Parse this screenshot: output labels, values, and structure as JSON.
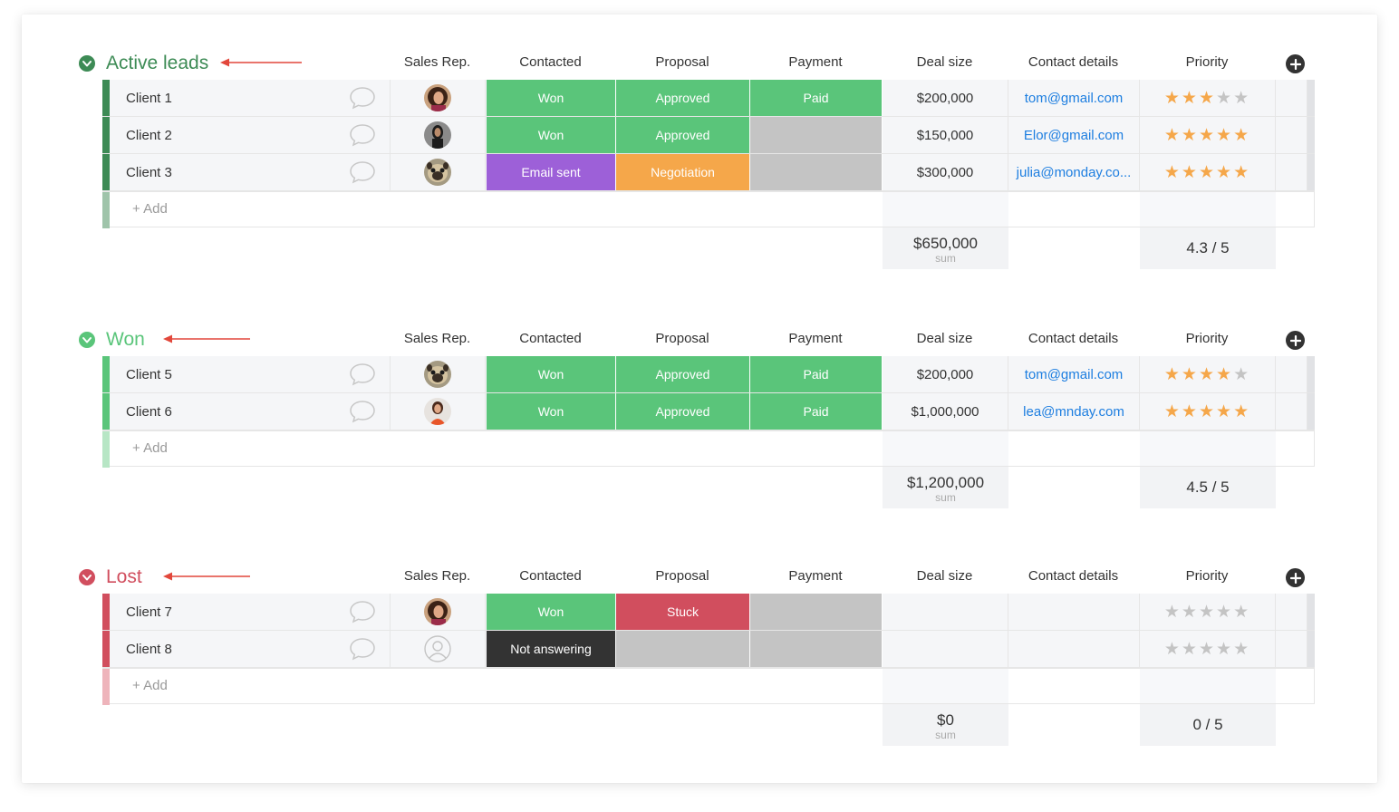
{
  "columns": {
    "sales_rep": "Sales Rep.",
    "contacted": "Contacted",
    "proposal": "Proposal",
    "payment": "Payment",
    "deal_size": "Deal size",
    "contact_details": "Contact details",
    "priority": "Priority"
  },
  "colors": {
    "won_green": "#5ac57a",
    "approved_green": "#5ac57a",
    "paid_green": "#5ac57a",
    "email_sent_purple": "#9d60d8",
    "negotiation_orange": "#f5a74a",
    "stuck_red": "#d14e5e",
    "not_answering_black": "#333333",
    "empty_gray": "#c4c4c4",
    "star_orange": "#f5a74a",
    "star_gray": "#c4c4c4",
    "link_blue": "#1d7ee0"
  },
  "groups": [
    {
      "title": "Active leads",
      "color": "#3d8b55",
      "add_bar_color": "#9fc4aa",
      "add_label": "+ Add",
      "rows": [
        {
          "name": "Client 1",
          "avatar": "woman-curly-hair",
          "contacted": "Won",
          "contacted_color": "#5ac57a",
          "proposal": "Approved",
          "proposal_color": "#5ac57a",
          "payment": "Paid",
          "payment_color": "#5ac57a",
          "deal_size": "$200,000",
          "email": "tom@gmail.com",
          "stars": 3
        },
        {
          "name": "Client 2",
          "avatar": "woman-dark-hair",
          "contacted": "Won",
          "contacted_color": "#5ac57a",
          "proposal": "Approved",
          "proposal_color": "#5ac57a",
          "payment": "",
          "payment_color": "#c4c4c4",
          "deal_size": "$150,000",
          "email": "Elor@gmail.com",
          "stars": 5
        },
        {
          "name": "Client 3",
          "avatar": "pug-dog",
          "contacted": "Email sent",
          "contacted_color": "#9d60d8",
          "proposal": "Negotiation",
          "proposal_color": "#f5a74a",
          "payment": "",
          "payment_color": "#c4c4c4",
          "deal_size": "$300,000",
          "email": "julia@monday.co...",
          "stars": 5
        }
      ],
      "summary": {
        "deal_total": "$650,000",
        "deal_label": "sum",
        "priority": "4.3 / 5"
      }
    },
    {
      "title": "Won",
      "color": "#5ac57a",
      "add_bar_color": "#b7e6c5",
      "add_label": "+ Add",
      "rows": [
        {
          "name": "Client 5",
          "avatar": "pug-dog",
          "contacted": "Won",
          "contacted_color": "#5ac57a",
          "proposal": "Approved",
          "proposal_color": "#5ac57a",
          "payment": "Paid",
          "payment_color": "#5ac57a",
          "deal_size": "$200,000",
          "email": "tom@gmail.com",
          "stars": 4
        },
        {
          "name": "Client 6",
          "avatar": "woman-orange-top",
          "contacted": "Won",
          "contacted_color": "#5ac57a",
          "proposal": "Approved",
          "proposal_color": "#5ac57a",
          "payment": "Paid",
          "payment_color": "#5ac57a",
          "deal_size": "$1,000,000",
          "email": "lea@mnday.com",
          "stars": 5
        }
      ],
      "summary": {
        "deal_total": "$1,200,000",
        "deal_label": "sum",
        "priority": "4.5 / 5"
      }
    },
    {
      "title": "Lost",
      "color": "#d14e5e",
      "add_bar_color": "#eeb4bb",
      "add_label": "+ Add",
      "rows": [
        {
          "name": "Client 7",
          "avatar": "woman-curly-hair",
          "contacted": "Won",
          "contacted_color": "#5ac57a",
          "proposal": "Stuck",
          "proposal_color": "#d14e5e",
          "payment": "",
          "payment_color": "#c4c4c4",
          "deal_size": "",
          "email": "",
          "stars": 0
        },
        {
          "name": "Client 8",
          "avatar": "empty-user",
          "contacted": "Not answering",
          "contacted_color": "#333333",
          "proposal": "",
          "proposal_color": "#c4c4c4",
          "payment": "",
          "payment_color": "#c4c4c4",
          "deal_size": "",
          "email": "",
          "stars": 0
        }
      ],
      "summary": {
        "deal_total": "$0",
        "deal_label": "sum",
        "priority": "0 / 5"
      }
    }
  ]
}
